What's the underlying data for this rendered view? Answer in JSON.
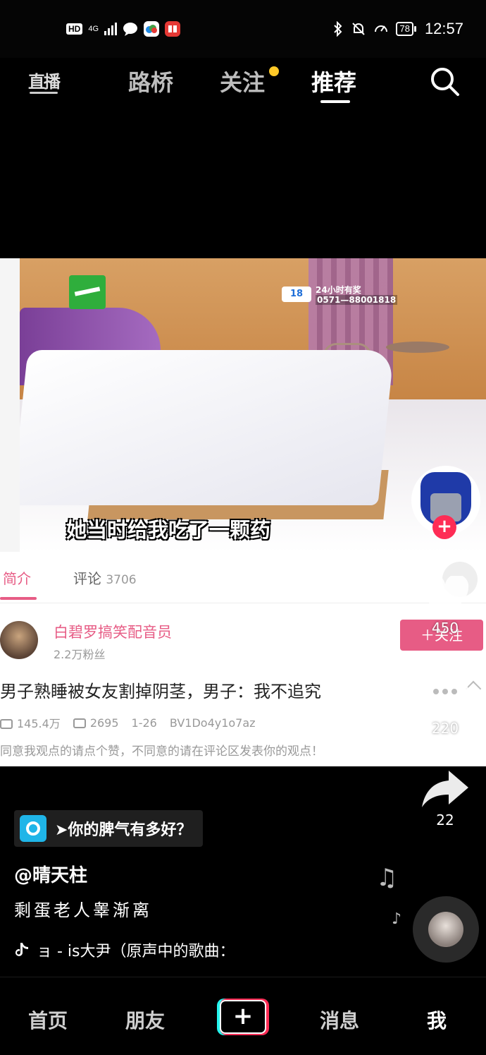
{
  "status_bar": {
    "hd": "HD",
    "network": "4G",
    "battery": "78",
    "time": "12:57"
  },
  "top_nav": {
    "live": "直播",
    "tabs": [
      "路桥",
      "关注",
      "推荐"
    ],
    "active_tab": "推荐"
  },
  "video": {
    "tv_hotline_line1": "24小时有奖",
    "tv_hotline_line2": "0571—88001818",
    "subtitle": "她当时给我吃了一颗药"
  },
  "info_panel": {
    "tab_intro": "简介",
    "tab_comments": "评论",
    "comments_count": "3706",
    "uploader_name": "白碧罗搞笑配音员",
    "uploader_fans": "2.2万粉丝",
    "follow_label": "＋关注",
    "title": "男子熟睡被女友割掉阴茎，男子：我不追究",
    "views": "145.4万",
    "danmaku": "2695",
    "date": "1-26",
    "bvid": "BV1Do4y1o7az",
    "description": "同意我观点的请点个赞，不同意的请在评论区发表你的观点！"
  },
  "actions": {
    "likes": "450",
    "comments": "220",
    "shares": "22"
  },
  "overlay": {
    "promo_text": "➤你的脾气有多好？",
    "author": "@晴天柱",
    "caption": "剩蛋老人睾渐离",
    "music": "ョ - is大尹（原声中的歌曲："
  },
  "bottom_bar": {
    "home": "首页",
    "friends": "朋友",
    "create": "+",
    "messages": "消息",
    "me": "我"
  },
  "colors": {
    "accent_pink": "#e75c85",
    "tiktok_red": "#fe2c55",
    "tiktok_cyan": "#25f4ee",
    "notify_dot": "#ffc928"
  }
}
